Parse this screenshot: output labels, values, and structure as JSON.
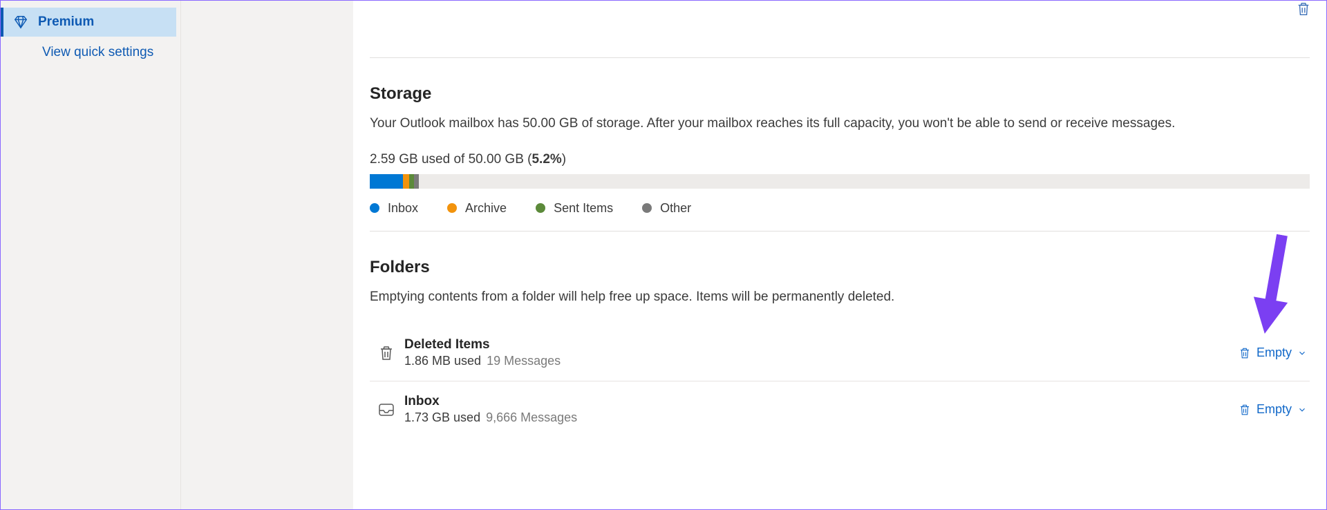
{
  "sidebar": {
    "premium_label": "Premium",
    "quick_settings_label": "View quick settings"
  },
  "storage": {
    "title": "Storage",
    "description": "Your Outlook mailbox has 50.00 GB of storage. After your mailbox reaches its full capacity, you won't be able to send or receive messages.",
    "usage_prefix": "2.59 GB used of 50.00 GB (",
    "usage_percent": "5.2%",
    "usage_suffix": ")",
    "segments": [
      {
        "name": "Inbox",
        "color": "#0078d4",
        "width_pct": 3.5
      },
      {
        "name": "Archive",
        "color": "#f2930d",
        "width_pct": 0.7
      },
      {
        "name": "Sent Items",
        "color": "#5c8a3a",
        "width_pct": 0.5
      },
      {
        "name": "Other",
        "color": "#7a7a7a",
        "width_pct": 0.5
      }
    ],
    "legend": [
      {
        "label": "Inbox",
        "color": "#0078d4"
      },
      {
        "label": "Archive",
        "color": "#f2930d"
      },
      {
        "label": "Sent Items",
        "color": "#5c8a3a"
      },
      {
        "label": "Other",
        "color": "#7a7a7a"
      }
    ]
  },
  "folders": {
    "title": "Folders",
    "description": "Emptying contents from a folder will help free up space. Items will be permanently deleted.",
    "empty_label": "Empty",
    "items": [
      {
        "icon": "trash",
        "name": "Deleted Items",
        "used": "1.86 MB used",
        "messages": "19 Messages"
      },
      {
        "icon": "inbox",
        "name": "Inbox",
        "used": "1.73 GB used",
        "messages": "9,666 Messages"
      }
    ]
  }
}
